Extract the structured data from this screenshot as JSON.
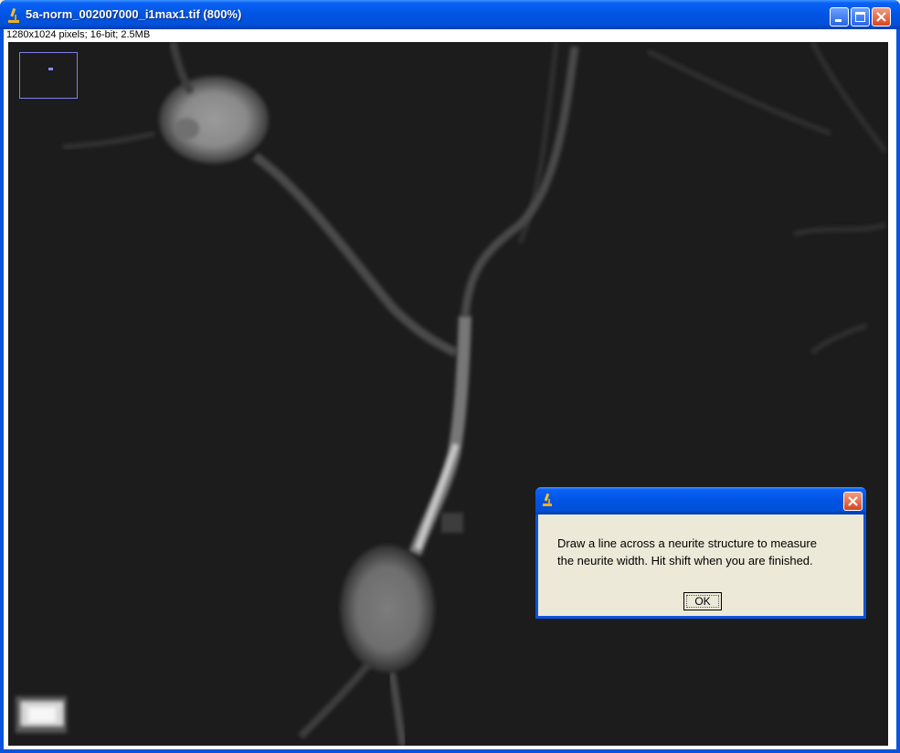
{
  "window": {
    "title": "5a-norm_002007000_i1max1.tif (800%)",
    "icon": "imagej-microscope-icon",
    "buttons": [
      "minimize",
      "maximize",
      "close"
    ]
  },
  "image_info": {
    "text": "1280x1024 pixels; 16-bit; 2.5MB"
  },
  "dialog": {
    "icon": "imagej-microscope-icon",
    "message_line1": "Draw a line across a neurite structure to measure",
    "message_line2": "the neurite width. Hit shift when you are finished.",
    "ok_label": "OK"
  },
  "colors": {
    "titlebar": "#0054e3",
    "close_button": "#d6461f",
    "image_background": "#1c1c1c",
    "navigator_outline": "#7f7fe8"
  }
}
